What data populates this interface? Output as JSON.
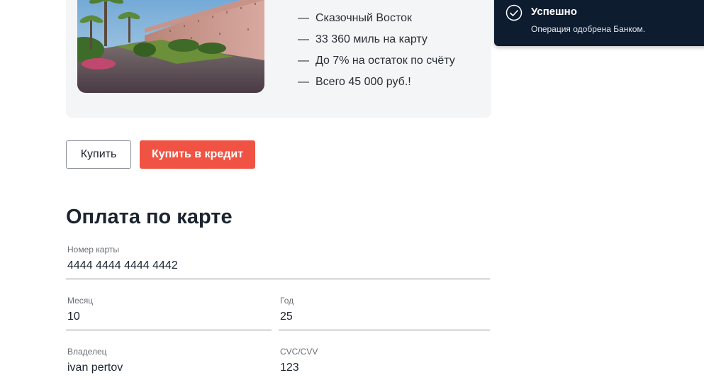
{
  "offer": {
    "image_alt": "marrakech-city-wall-photo",
    "features": [
      {
        "dash": "—",
        "text": "Сказочный Восток"
      },
      {
        "dash": "—",
        "text": "33 360 миль на карту"
      },
      {
        "dash": "—",
        "text": "До 7% на остаток по счёту"
      },
      {
        "dash": "—",
        "text": "Всего 45 000 руб.!"
      }
    ]
  },
  "actions": {
    "buy_label": "Купить",
    "credit_label": "Купить в кредит",
    "accent_color": "#f05343"
  },
  "payment_form": {
    "title": "Оплата по карте",
    "card_number": {
      "label": "Номер карты",
      "value": "4444 4444 4444 4442"
    },
    "month": {
      "label": "Месяц",
      "value": "10"
    },
    "year": {
      "label": "Год",
      "value": "25"
    },
    "owner": {
      "label": "Владелец",
      "value": "ivan pertov"
    },
    "cvc": {
      "label": "CVC/CVV",
      "value": "123"
    }
  },
  "notification": {
    "icon": "check-circle-icon",
    "title": "Успешно",
    "message": "Операция одобрена Банком.",
    "background": "#0e1c2f"
  }
}
